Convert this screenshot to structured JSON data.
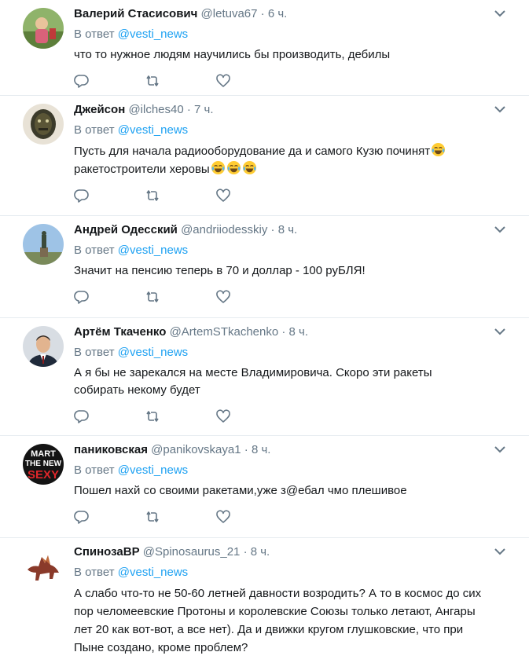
{
  "reply_prefix": "В ответ",
  "tweets": [
    {
      "name": "Валерий Стасисович",
      "handle": "@letuva67",
      "dot": "·",
      "time": "6 ч.",
      "mention": "@vesti_news",
      "text": "что то нужное людям научились бы производить, дебилы"
    },
    {
      "name": "Джейсон",
      "handle": "@ilches40",
      "dot": "·",
      "time": "7 ч.",
      "mention": "@vesti_news",
      "text1": "Пусть для начала радиооборудование да и самого Кузю починят",
      "text2": "ракетостроители херовы"
    },
    {
      "name": "Андрей Одесский",
      "handle": "@andriiodesskiy",
      "dot": "·",
      "time": "8 ч.",
      "mention": "@vesti_news",
      "text": "Значит на пенсию теперь в 70 и доллар - 100 руБЛЯ!"
    },
    {
      "name": "Артём Ткаченко",
      "handle": "@ArtemSTkachenko",
      "dot": "·",
      "time": "8 ч.",
      "mention": "@vesti_news",
      "text": "А я бы не зарекался на месте Владимировича. Скоро эти ракеты собирать некому будет"
    },
    {
      "name": "паниковская",
      "handle": "@panikovskaya1",
      "dot": "·",
      "time": "8 ч.",
      "mention": "@vesti_news",
      "avatar_text": [
        "MART",
        "THE NEW",
        "SEXY"
      ],
      "text": "Пошел нахй со своими ракетами,уже з@ебал чмо плешивое"
    },
    {
      "name": "СпинозаВР",
      "handle": "@Spinosaurus_21",
      "dot": "·",
      "time": "8 ч.",
      "mention": "@vesti_news",
      "text": "А слабо что-то не 50-60 летней давности возродить? А то в космос до сих пор челомеевские Протоны и королевские Союзы только летают, Ангары лет 20 как вот-вот, а все нет). Да и движки кругом глушковские, что при Пыне создано, кроме проблем?"
    }
  ],
  "icons": {
    "reply": "reply-icon",
    "retweet": "retweet-icon",
    "like": "heart-icon",
    "menu": "chevron-down-icon",
    "emoji": "crying-laughing-emoji"
  },
  "colors": {
    "name": "#14171a",
    "muted": "#657786",
    "link": "#1da1f2",
    "divider": "#e6ecf0"
  }
}
